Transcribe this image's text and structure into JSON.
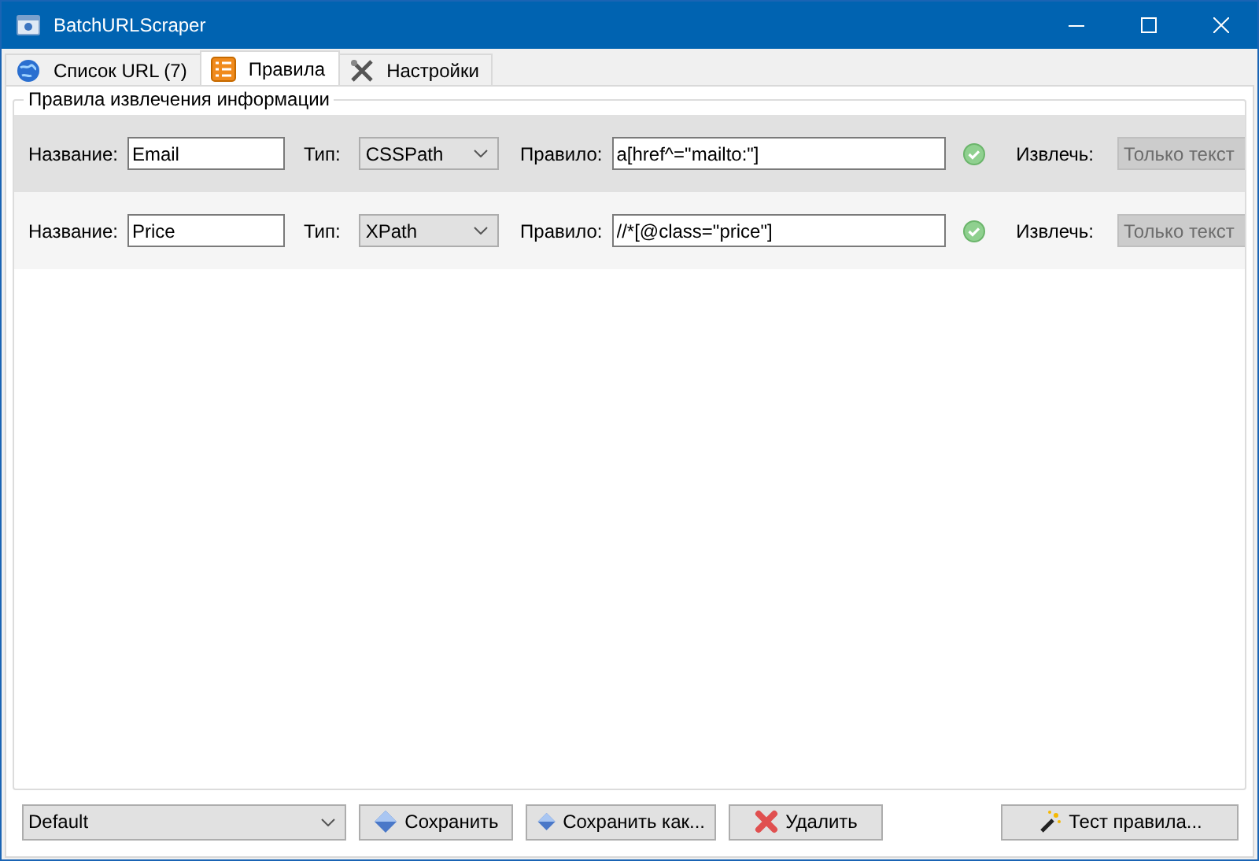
{
  "window": {
    "title": "BatchURLScraper"
  },
  "tabs": [
    {
      "label": "Список URL (7)",
      "selected": false
    },
    {
      "label": "Правила",
      "selected": true
    },
    {
      "label": "Настройки",
      "selected": false
    }
  ],
  "group": {
    "title": "Правила извлечения информации"
  },
  "rules": [
    {
      "selected": true,
      "name_label": "Название:",
      "name": "Email",
      "type_label": "Тип:",
      "type": "CSSPath",
      "rule_label": "Правило:",
      "rule": "a[href^=\"mailto:\"]",
      "valid": true,
      "extract_label": "Извлечь:",
      "extract": "Только текст",
      "extract_disabled": true
    },
    {
      "selected": false,
      "name_label": "Название:",
      "name": "Price",
      "type_label": "Тип:",
      "type": "XPath",
      "rule_label": "Правило:",
      "rule": "//*[@class=\"price\"]",
      "valid": true,
      "extract_label": "Извлечь:",
      "extract": "Только текст",
      "extract_disabled": true
    }
  ],
  "footer": {
    "preset": "Default",
    "buttons": [
      {
        "label": "Сохранить"
      },
      {
        "label": "Сохранить как..."
      },
      {
        "label": "Удалить"
      },
      {
        "label": "Тест правила..."
      }
    ]
  }
}
